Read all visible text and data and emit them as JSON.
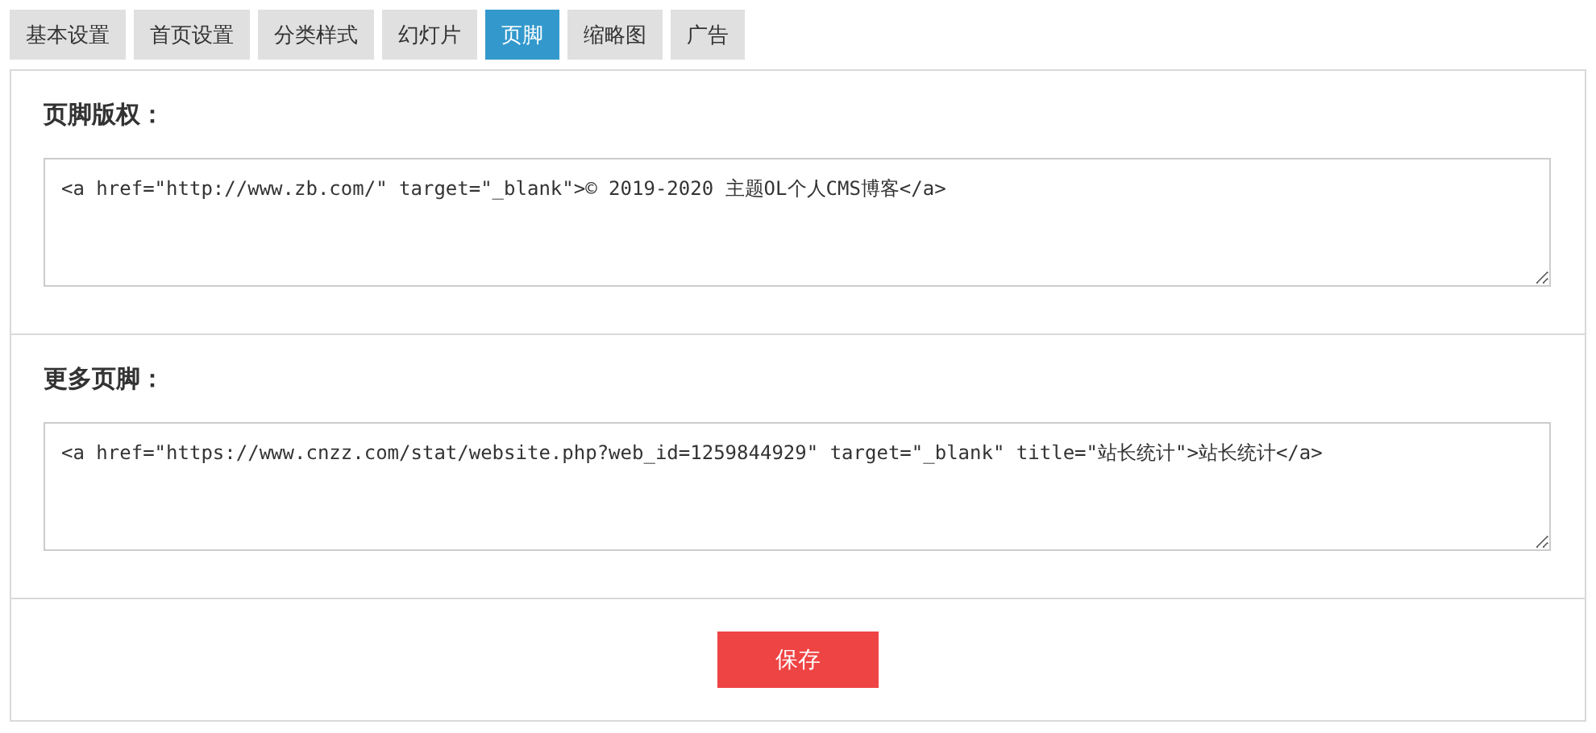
{
  "tabs": [
    {
      "label": "基本设置",
      "selected": false
    },
    {
      "label": "首页设置",
      "selected": false
    },
    {
      "label": "分类样式",
      "selected": false
    },
    {
      "label": "幻灯片",
      "selected": false
    },
    {
      "label": "页脚",
      "selected": true
    },
    {
      "label": "缩略图",
      "selected": false
    },
    {
      "label": "广告",
      "selected": false
    }
  ],
  "sections": [
    {
      "label": "页脚版权：",
      "value": "<a href=\"http://www.zb.com/\" target=\"_blank\">© 2019-2020 主题OL个人CMS博客</a>"
    },
    {
      "label": "更多页脚：",
      "value": "<a href=\"https://www.cnzz.com/stat/website.php?web_id=1259844929\" target=\"_blank\" title=\"站长统计\">站长统计</a>"
    }
  ],
  "save_button": "保存"
}
